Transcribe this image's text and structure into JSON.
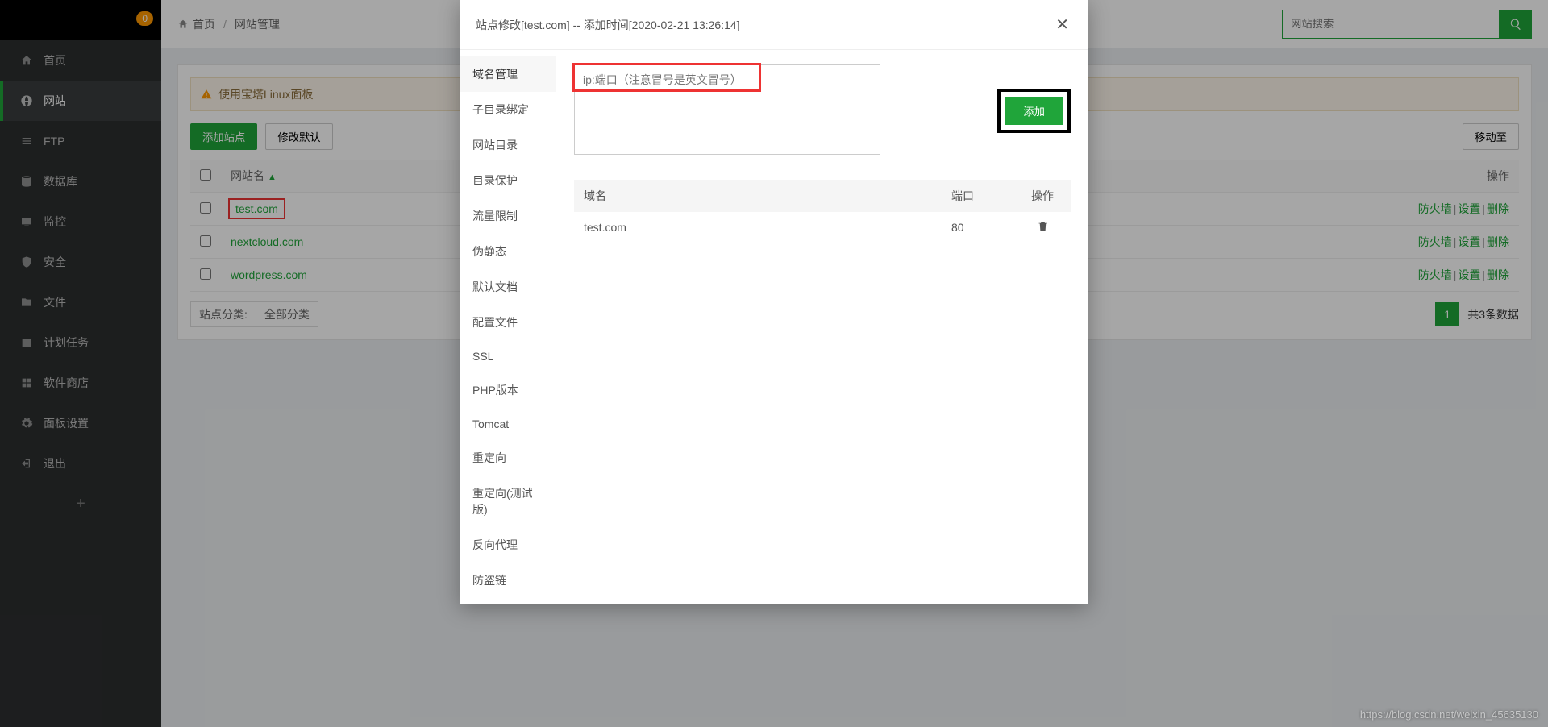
{
  "sidebar": {
    "badge": "0",
    "items": [
      {
        "label": "首页"
      },
      {
        "label": "网站"
      },
      {
        "label": "FTP"
      },
      {
        "label": "数据库"
      },
      {
        "label": "监控"
      },
      {
        "label": "安全"
      },
      {
        "label": "文件"
      },
      {
        "label": "计划任务"
      },
      {
        "label": "软件商店"
      },
      {
        "label": "面板设置"
      },
      {
        "label": "退出"
      }
    ]
  },
  "breadcrumb": {
    "home": "首页",
    "current": "网站管理"
  },
  "search": {
    "placeholder": "网站搜索"
  },
  "warn_text": "使用宝塔Linux面板",
  "toolbar": {
    "add_site": "添加站点",
    "edit_default": "修改默认",
    "move_to": "移动至"
  },
  "table": {
    "col_site": "网站名",
    "col_actions": "操作",
    "rows": [
      {
        "site": "test.com",
        "highlight": true
      },
      {
        "site": "nextcloud.com",
        "highlight": false
      },
      {
        "site": "wordpress.com",
        "highlight": false
      }
    ],
    "action_firewall": "防火墙",
    "action_settings": "设置",
    "action_delete": "删除"
  },
  "footer": {
    "category_label": "站点分类:",
    "category_value": "全部分类",
    "page": "1",
    "total_text": "共3条数据"
  },
  "modal": {
    "title": "站点修改[test.com] -- 添加时间[2020-02-21 13:26:14]",
    "tabs": [
      "域名管理",
      "子目录绑定",
      "网站目录",
      "目录保护",
      "流量限制",
      "伪静态",
      "默认文档",
      "配置文件",
      "SSL",
      "PHP版本",
      "Tomcat",
      "重定向",
      "重定向(测试版)",
      "反向代理",
      "防盗链"
    ],
    "textarea_placeholder": "ip:端口（注意冒号是英文冒号）",
    "add_btn": "添加",
    "dcol_domain": "域名",
    "dcol_port": "端口",
    "dcol_op": "操作",
    "drow_domain": "test.com",
    "drow_port": "80"
  },
  "watermark": "https://blog.csdn.net/weixin_45635130"
}
